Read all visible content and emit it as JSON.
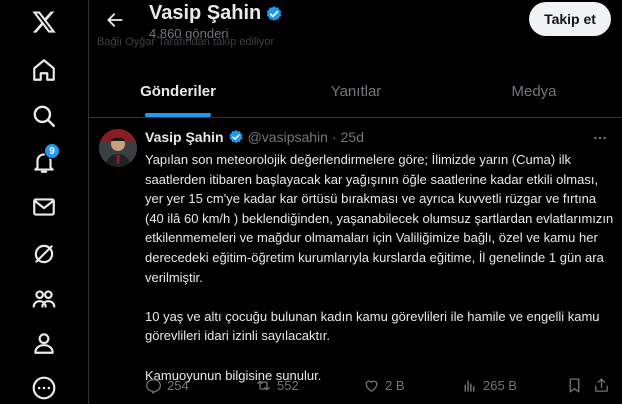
{
  "nav": {
    "notifications_badge": "9"
  },
  "profile": {
    "name": "Vasip Şahin",
    "post_count": "4.860 gönderi",
    "faded_text": "Bağlı Oyğar Tarafından takip ediliyor",
    "follow_label": "Takip et"
  },
  "tabs": [
    {
      "label": "Gönderiler",
      "active": true
    },
    {
      "label": "Yanıtlar",
      "active": false
    },
    {
      "label": "Medya",
      "active": false
    }
  ],
  "tweet": {
    "author_name": "Vasip Şahin",
    "handle": "@vasipsahin",
    "separator": "·",
    "time": "25d",
    "paragraphs": [
      "Yapılan son meteorolojik değerlendirmelere göre; İlimizde yarın (Cuma) ilk saatlerden itibaren başlayacak kar yağışının öğle saatlerine kadar etkili olması, yer yer 15 cm'ye kadar kar örtüsü bırakması ve ayrıca kuvvetli rüzgar ve fırtına (40 ilâ 60 km/h ) beklendiğinden, yaşanabilecek olumsuz şartlardan evlatlarımızın etkilenmemeleri ve mağdur olmamaları için Valiliğimize bağlı, özel ve kamu her derecedeki eğitim-öğretim kurumlarıyla kurslarda eğitime, İl genelinde 1 gün ara verilmiştir.",
      "10 yaş ve altı çocuğu bulunan kadın kamu görevlileri ile hamile ve engelli kamu görevlileri idari izinli sayılacaktır.",
      "Kamuoyunun bilgisine sunulur."
    ],
    "replies": "254",
    "reposts": "552",
    "likes": "2 B",
    "views": "265 B"
  },
  "colors": {
    "accent": "#1d9bf0",
    "text_primary": "#e7e9ea",
    "text_secondary": "#71767b",
    "background": "#000000",
    "divider": "#2f3336"
  },
  "icons": [
    "x-logo-icon",
    "home-icon",
    "search-icon",
    "bell-icon",
    "mail-icon",
    "grok-icon",
    "communities-icon",
    "profile-icon",
    "more-circle-icon",
    "back-arrow-icon",
    "verified-badge-icon",
    "more-dots-icon",
    "reply-icon",
    "repost-icon",
    "like-icon",
    "views-icon",
    "bookmark-icon",
    "share-icon"
  ]
}
